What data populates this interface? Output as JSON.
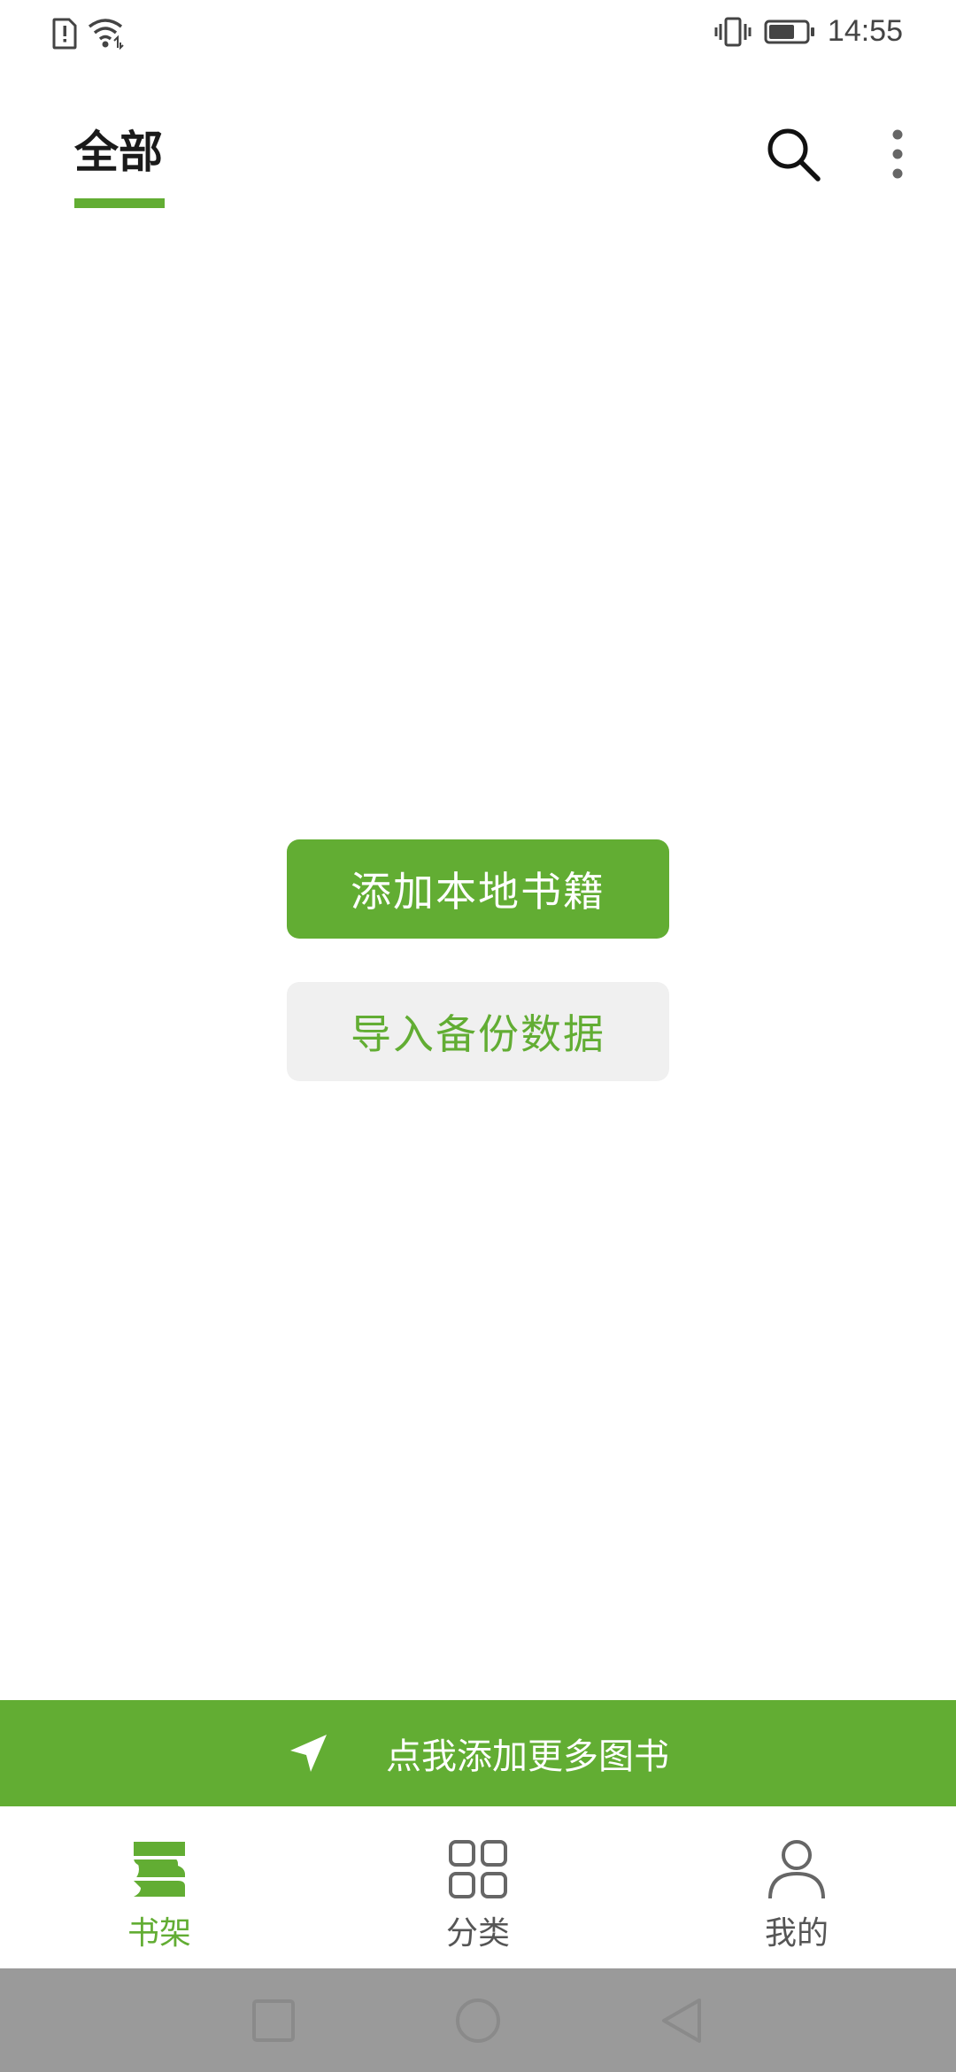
{
  "status_bar": {
    "time": "14:55",
    "icons": [
      "sim-alert-icon",
      "wifi-icon",
      "vibrate-icon",
      "battery-icon"
    ],
    "battery_level": 0.7
  },
  "header": {
    "tab_label": "全部",
    "icons": [
      "search-icon",
      "more-vertical-icon"
    ]
  },
  "main": {
    "add_local_books_label": "添加本地书籍",
    "import_backup_label": "导入备份数据"
  },
  "banner": {
    "label": "点我添加更多图书",
    "icon": "navigation-arrow-icon"
  },
  "bottom_nav": {
    "items": [
      {
        "label": "书架",
        "icon": "bookshelf-icon",
        "active": true
      },
      {
        "label": "分类",
        "icon": "grid-icon",
        "active": false
      },
      {
        "label": "我的",
        "icon": "person-icon",
        "active": false
      }
    ]
  },
  "system_nav": {
    "icons": [
      "recent-apps-icon",
      "home-icon",
      "back-icon"
    ]
  },
  "colors": {
    "accent": "#62ad33",
    "secondary_bg": "#f0f0f0",
    "system_nav_bg": "#9a9a9a"
  }
}
